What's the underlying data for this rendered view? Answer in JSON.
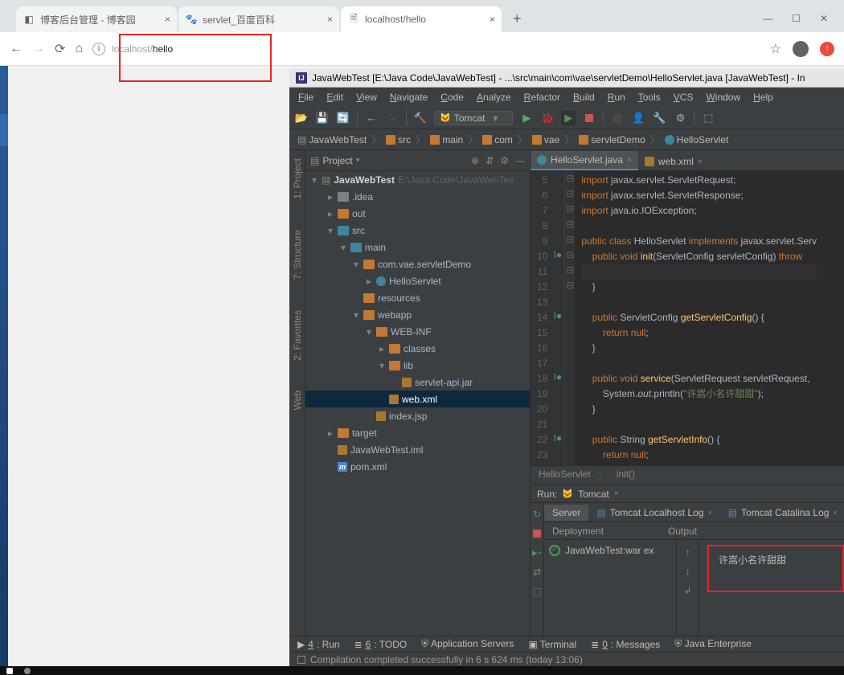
{
  "browser": {
    "tabs": [
      {
        "favicon": "cnblogs",
        "title": "博客后台管理 - 博客园"
      },
      {
        "favicon": "baidu",
        "title": "servlet_百度百科"
      },
      {
        "favicon": "page",
        "title": "localhost/hello",
        "active": true
      }
    ],
    "address": {
      "host": "localhost/",
      "path": "hello"
    }
  },
  "ide": {
    "title": "JavaWebTest [E:\\Java Code\\JavaWebTest] - ...\\src\\main\\com\\vae\\servletDemo\\HelloServlet.java [JavaWebTest] - In",
    "menus": [
      "File",
      "Edit",
      "View",
      "Navigate",
      "Code",
      "Analyze",
      "Refactor",
      "Build",
      "Run",
      "Tools",
      "VCS",
      "Window",
      "Help"
    ],
    "run_config": "Tomcat",
    "breadcrumbs": [
      "JavaWebTest",
      "src",
      "main",
      "com",
      "vae",
      "servletDemo",
      "HelloServlet"
    ],
    "project": {
      "header": "Project",
      "root": {
        "name": "JavaWebTest",
        "hint": "E:\\Java Code\\JavaWebTes"
      },
      "tree": [
        {
          "d": 1,
          "tw": "▸",
          "ic": "dir-gray",
          "name": ".idea"
        },
        {
          "d": 1,
          "tw": "▸",
          "ic": "dir",
          "name": "out"
        },
        {
          "d": 1,
          "tw": "▾",
          "ic": "dir-blue",
          "name": "src"
        },
        {
          "d": 2,
          "tw": "▾",
          "ic": "dir-blue",
          "name": "main"
        },
        {
          "d": 3,
          "tw": "▾",
          "ic": "dir",
          "name": "com.vae.servletDemo"
        },
        {
          "d": 4,
          "tw": "▸",
          "ic": "java",
          "name": "HelloServlet"
        },
        {
          "d": 3,
          "tw": "",
          "ic": "dir",
          "name": "resources"
        },
        {
          "d": 3,
          "tw": "▾",
          "ic": "dir",
          "name": "webapp"
        },
        {
          "d": 4,
          "tw": "▾",
          "ic": "dir",
          "name": "WEB-INF"
        },
        {
          "d": 5,
          "tw": "▸",
          "ic": "dir",
          "name": "classes"
        },
        {
          "d": 5,
          "tw": "▾",
          "ic": "dir",
          "name": "lib"
        },
        {
          "d": 6,
          "tw": "",
          "ic": "jar",
          "name": "servlet-api.jar"
        },
        {
          "d": 5,
          "tw": "",
          "ic": "xml",
          "name": "web.xml",
          "sel": true
        },
        {
          "d": 4,
          "tw": "",
          "ic": "jsp",
          "name": "index.jsp"
        },
        {
          "d": 1,
          "tw": "▸",
          "ic": "dir",
          "name": "target"
        },
        {
          "d": 1,
          "tw": "",
          "ic": "iml",
          "name": "JavaWebTest.iml"
        },
        {
          "d": 1,
          "tw": "",
          "ic": "m",
          "name": "pom.xml"
        }
      ]
    },
    "editor": {
      "tabs": [
        {
          "ic": "java",
          "name": "HelloServlet.java",
          "active": true
        },
        {
          "ic": "xml",
          "name": "web.xml"
        }
      ],
      "first_line_no": 5,
      "crumbs": [
        "HelloServlet",
        "init()"
      ]
    },
    "code_lines": [
      {
        "n": 5,
        "t": "import javax.servlet.ServletRequest;",
        "seg": [
          [
            "kw",
            "import "
          ],
          [
            "pkg",
            "javax.servlet.ServletRequest"
          ],
          [
            "",
            ";"
          ]
        ]
      },
      {
        "n": 6,
        "t": "import javax.servlet.ServletResponse;",
        "seg": [
          [
            "kw",
            "import "
          ],
          [
            "pkg",
            "javax.servlet.ServletResponse"
          ],
          [
            "",
            ";"
          ]
        ]
      },
      {
        "n": 7,
        "t": "import java.io.IOException;",
        "seg": [
          [
            "kw",
            "import "
          ],
          [
            "pkg",
            "java.io.IOException"
          ],
          [
            "",
            ";"
          ]
        ],
        "fold": "⊟"
      },
      {
        "n": 8,
        "t": ""
      },
      {
        "n": 9,
        "t": "public class HelloServlet implements javax.servlet.Serv",
        "seg": [
          [
            "kw",
            "public class "
          ],
          [
            "typ",
            "HelloServlet "
          ],
          [
            "kw",
            "implements "
          ],
          [
            "pkg",
            "javax.servlet.Serv"
          ]
        ]
      },
      {
        "n": 10,
        "mark": "I●",
        "fold": "⊟",
        "t": "    public void init(ServletConfig servletConfig) throw",
        "seg": [
          [
            "",
            "    "
          ],
          [
            "kw",
            "public "
          ],
          [
            "kw",
            "void "
          ],
          [
            "fn",
            "init"
          ],
          [
            "",
            "(ServletConfig servletConfig) "
          ],
          [
            "kw",
            "throw"
          ]
        ]
      },
      {
        "n": 11,
        "caret": true,
        "t": ""
      },
      {
        "n": 12,
        "fold": "⊟",
        "t": "    }",
        "seg": [
          [
            "",
            "    }"
          ]
        ]
      },
      {
        "n": 13,
        "t": ""
      },
      {
        "n": 14,
        "mark": "I●",
        "fold": "⊟",
        "t": "    public ServletConfig getServletConfig() {",
        "seg": [
          [
            "",
            "    "
          ],
          [
            "kw",
            "public "
          ],
          [
            "typ",
            "ServletConfig "
          ],
          [
            "fn",
            "getServletConfig"
          ],
          [
            "",
            "() {"
          ]
        ]
      },
      {
        "n": 15,
        "t": "        return null;",
        "seg": [
          [
            "",
            "        "
          ],
          [
            "kw",
            "return "
          ],
          [
            "kw",
            "null"
          ],
          [
            "",
            ";"
          ]
        ]
      },
      {
        "n": 16,
        "fold": "⊟",
        "t": "    }",
        "seg": [
          [
            "",
            "    }"
          ]
        ]
      },
      {
        "n": 17,
        "t": ""
      },
      {
        "n": 18,
        "mark": "I●",
        "fold": "⊟",
        "t": "    public void service(ServletRequest servletRequest,",
        "seg": [
          [
            "",
            "    "
          ],
          [
            "kw",
            "public "
          ],
          [
            "kw",
            "void "
          ],
          [
            "fn",
            "service"
          ],
          [
            "",
            "(ServletRequest servletRequest,"
          ]
        ]
      },
      {
        "n": 19,
        "t": "        System.out.println(\"许嵩小名许甜甜\");",
        "seg": [
          [
            "",
            "        System."
          ],
          [
            "it",
            "out"
          ],
          [
            "",
            ".println("
          ],
          [
            "str",
            "\"许嵩小名许甜甜\""
          ],
          [
            "",
            ");"
          ]
        ]
      },
      {
        "n": 20,
        "fold": "⊟",
        "t": "    }",
        "seg": [
          [
            "",
            "    }"
          ]
        ]
      },
      {
        "n": 21,
        "t": ""
      },
      {
        "n": 22,
        "mark": "I●",
        "fold": "⊟",
        "t": "    public String getServletInfo() {",
        "seg": [
          [
            "",
            "    "
          ],
          [
            "kw",
            "public "
          ],
          [
            "typ",
            "String "
          ],
          [
            "fn",
            "getServletInfo"
          ],
          [
            "",
            "() {"
          ]
        ]
      },
      {
        "n": 23,
        "t": "        return null;",
        "seg": [
          [
            "",
            "        "
          ],
          [
            "kw",
            "return "
          ],
          [
            "kw",
            "null"
          ],
          [
            "",
            ";"
          ]
        ]
      }
    ],
    "run": {
      "label": "Run:",
      "config": "Tomcat",
      "tabs": [
        "Server",
        "Tomcat Localhost Log",
        "Tomcat Catalina Log"
      ],
      "dep_label": "Deployment",
      "out_label": "Output",
      "artifact": "JavaWebTest:war ex",
      "output_text": "许嵩小名许甜甜"
    },
    "bottom_tools": [
      {
        "u": "4",
        "label": ": Run",
        "pre": "▶"
      },
      {
        "u": "6",
        "label": ": TODO",
        "pre": "≣"
      },
      {
        "label": "Application Servers",
        "pre": "⛨"
      },
      {
        "label": "Terminal",
        "pre": "▣"
      },
      {
        "u": "0",
        "label": ": Messages",
        "pre": "≣"
      },
      {
        "label": "Java Enterprise",
        "pre": "⛨"
      }
    ],
    "status": "Compilation completed successfully in 6 s 624 ms (today 13:06)",
    "left_tools": [
      "1: Project",
      "7: Structure",
      "2: Favorites",
      "Web"
    ]
  }
}
